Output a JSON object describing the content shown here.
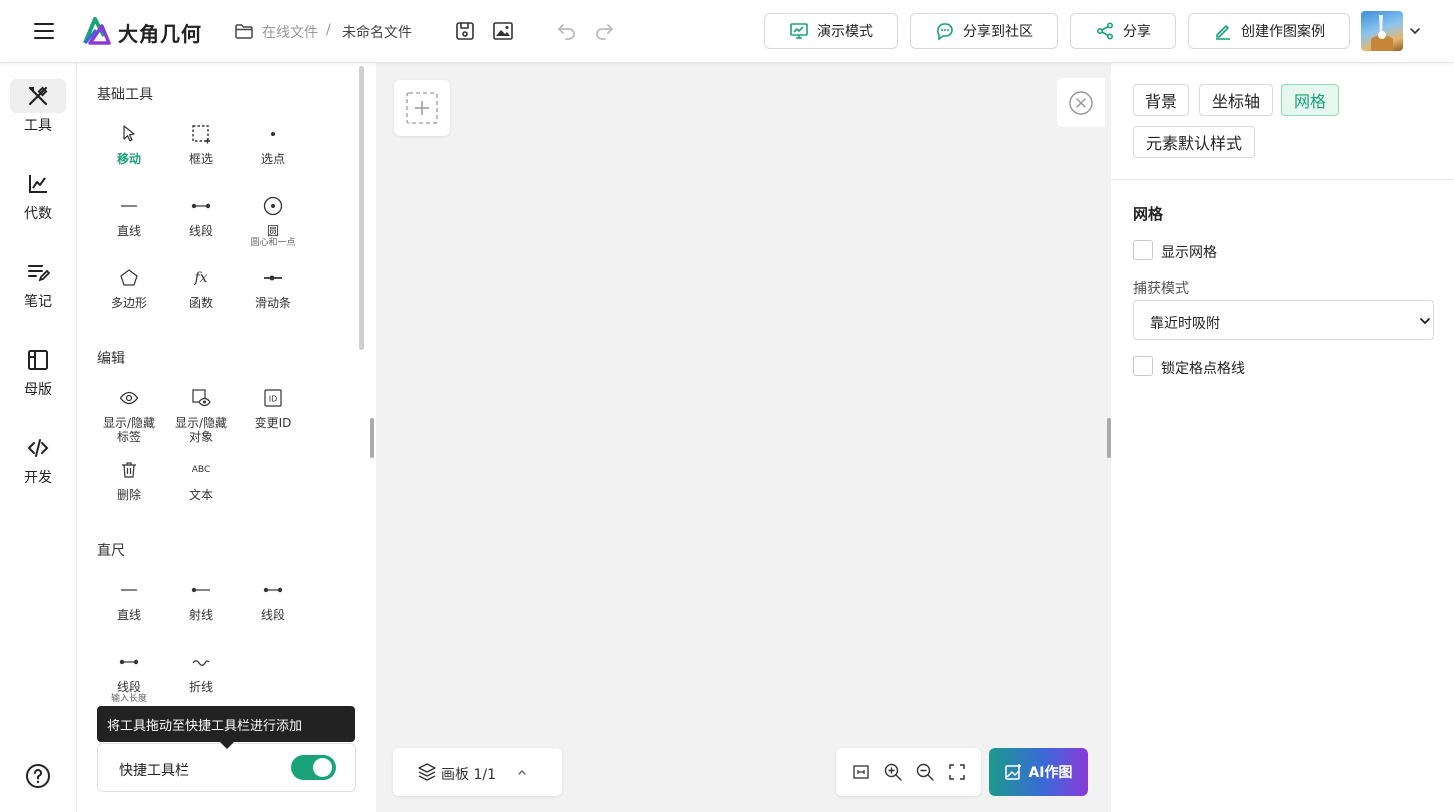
{
  "header": {
    "brand": "大角几何",
    "breadcrumb_root": "在线文件",
    "breadcrumb_sep": "/",
    "file_name": "未命名文件",
    "buttons": {
      "present": "演示模式",
      "share_community": "分享到社区",
      "share": "分享",
      "create_case": "创建作图案例"
    }
  },
  "nav": {
    "items": [
      {
        "label": "工具",
        "icon": "tools-icon"
      },
      {
        "label": "代数",
        "icon": "algebra-icon"
      },
      {
        "label": "笔记",
        "icon": "notes-icon"
      },
      {
        "label": "母版",
        "icon": "template-icon"
      },
      {
        "label": "开发",
        "icon": "code-icon"
      }
    ]
  },
  "tools": {
    "sections": {
      "basic": "基础工具",
      "edit": "编辑",
      "ruler": "直尺"
    },
    "basic": [
      {
        "label": "移动",
        "sub": ""
      },
      {
        "label": "框选",
        "sub": ""
      },
      {
        "label": "选点",
        "sub": ""
      },
      {
        "label": "直线",
        "sub": ""
      },
      {
        "label": "线段",
        "sub": ""
      },
      {
        "label": "圆",
        "sub": "圆心和一点"
      },
      {
        "label": "多边形",
        "sub": ""
      },
      {
        "label": "函数",
        "sub": ""
      },
      {
        "label": "滑动条",
        "sub": ""
      }
    ],
    "edit": [
      {
        "label": "显示/隐藏",
        "sub": "标签"
      },
      {
        "label": "显示/隐藏",
        "sub": "对象"
      },
      {
        "label": "变更ID",
        "sub": ""
      },
      {
        "label": "删除",
        "sub": ""
      },
      {
        "label": "文本",
        "sub": ""
      }
    ],
    "ruler": [
      {
        "label": "直线",
        "sub": ""
      },
      {
        "label": "射线",
        "sub": ""
      },
      {
        "label": "线段",
        "sub": ""
      },
      {
        "label": "线段",
        "sub": "输入长度"
      },
      {
        "label": "折线",
        "sub": ""
      }
    ],
    "fx_glyph": "fx",
    "abc_glyph": "ABC",
    "id_glyph": "ID",
    "tooltip": "将工具拖动至快捷工具栏进行添加",
    "quickbar_label": "快捷工具栏",
    "quickbar_enabled": true
  },
  "canvas": {
    "board_label": "画板 1/1",
    "ai_button": "AI作图"
  },
  "settings": {
    "tabs": [
      {
        "label": "背景",
        "active": false
      },
      {
        "label": "坐标轴",
        "active": false
      },
      {
        "label": "网格",
        "active": true
      },
      {
        "label": "元素默认样式",
        "active": false
      }
    ],
    "section_title": "网格",
    "show_grid": {
      "label": "显示网格",
      "checked": false
    },
    "capture_mode_label": "捕获模式",
    "capture_mode_value": "靠近时吸附",
    "lock_grid": {
      "label": "锁定格点格线",
      "checked": false
    }
  },
  "colors": {
    "accent": "#1aa37a",
    "accent_light": "#e5f7ef"
  }
}
